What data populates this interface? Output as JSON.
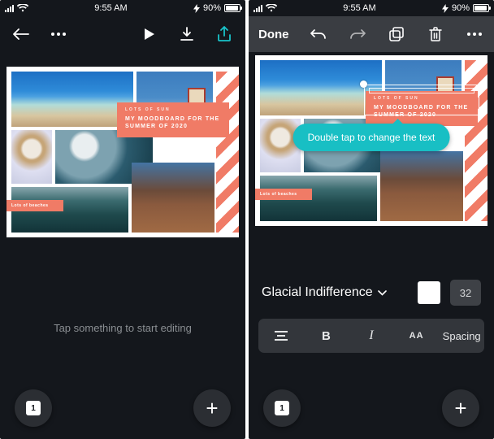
{
  "status": {
    "time": "9:55 AM",
    "battery_pct": "90%"
  },
  "left": {
    "hint": "Tap something to start editing",
    "page_number": "1"
  },
  "right": {
    "done": "Done",
    "tooltip": "Double tap to change the text",
    "font_name": "Glacial Indifference",
    "font_size": "32",
    "format": {
      "bold": "B",
      "italic": "I",
      "caps": "AA",
      "spacing": "Spacing"
    },
    "page_number": "1"
  },
  "moodboard": {
    "subhead": "LOTS OF SUN",
    "title_l1": "MY MOODBOARD FOR THE",
    "title_l2": "SUMMER OF 2020",
    "beaches": "Lots of beaches"
  },
  "colors": {
    "accent": "#19c3c9",
    "coral": "#f07b66",
    "panel": "#33363b"
  }
}
